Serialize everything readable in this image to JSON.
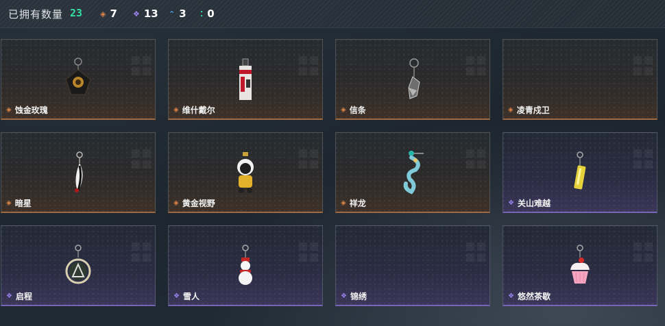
{
  "header": {
    "owned_label": "已拥有数量",
    "owned_count": "23",
    "stats": [
      {
        "icon": "orange-diamond-icon",
        "color": "#e0884a",
        "value": "7"
      },
      {
        "icon": "purple-diamond-icon",
        "color": "#9c82f0",
        "value": "13"
      },
      {
        "icon": "blue-chevron-icon",
        "color": "#4da3e8",
        "value": "3"
      },
      {
        "icon": "green-dots-icon",
        "color": "#33e0a3",
        "value": "0"
      }
    ]
  },
  "items": [
    {
      "name": "蚀金玫瑰",
      "rarity": "orange"
    },
    {
      "name": "维什戴尔",
      "rarity": "orange"
    },
    {
      "name": "信条",
      "rarity": "orange"
    },
    {
      "name": "凌青戍卫",
      "rarity": "orange"
    },
    {
      "name": "暗星",
      "rarity": "orange"
    },
    {
      "name": "黄金视野",
      "rarity": "orange"
    },
    {
      "name": "祥龙",
      "rarity": "orange"
    },
    {
      "name": "关山难越",
      "rarity": "purple"
    },
    {
      "name": "启程",
      "rarity": "purple"
    },
    {
      "name": "雪人",
      "rarity": "purple"
    },
    {
      "name": "锦绣",
      "rarity": "purple"
    },
    {
      "name": "悠然茶歇",
      "rarity": "purple"
    }
  ]
}
